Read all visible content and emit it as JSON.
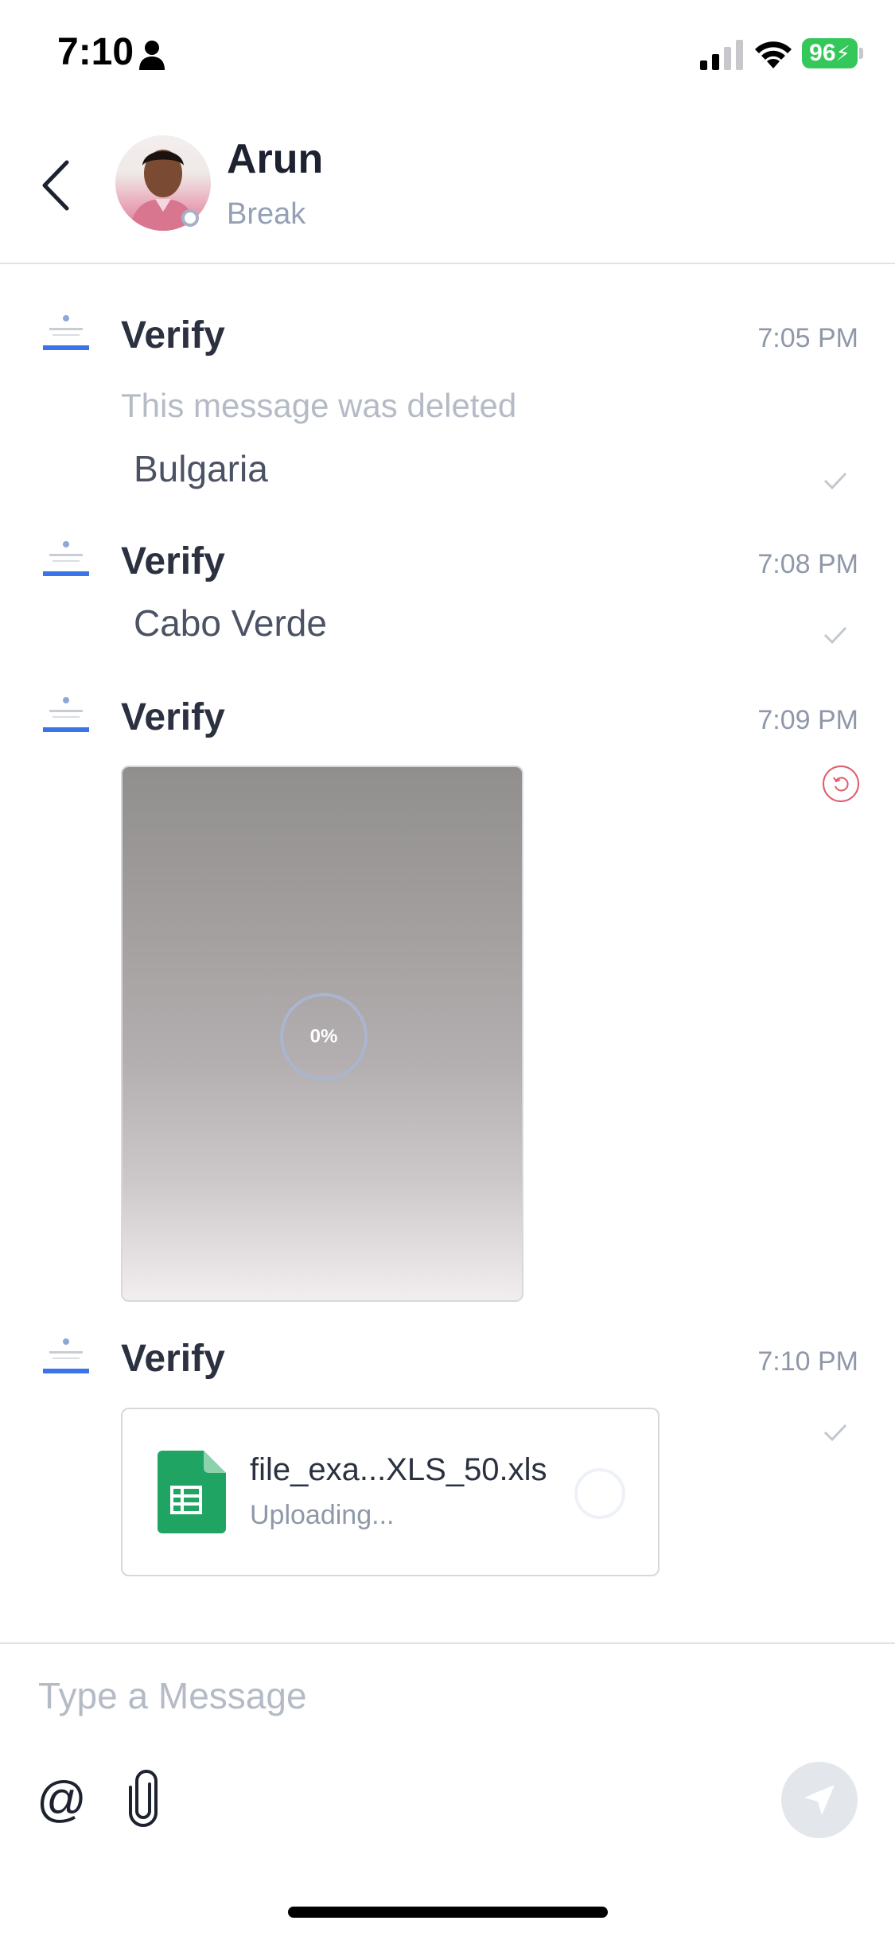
{
  "status_bar": {
    "time": "7:10",
    "battery": "96"
  },
  "header": {
    "name": "Arun",
    "status": "Break"
  },
  "messages": [
    {
      "sender": "Verify",
      "time": "7:05 PM",
      "deleted_text": "This message was deleted",
      "text": "Bulgaria"
    },
    {
      "sender": "Verify",
      "time": "7:08 PM",
      "text": "Cabo Verde"
    },
    {
      "sender": "Verify",
      "time": "7:09 PM",
      "image_progress": "0%"
    },
    {
      "sender": "Verify",
      "time": "7:10 PM",
      "file_name": "file_exa...XLS_50.xls",
      "file_status": "Uploading..."
    }
  ],
  "composer": {
    "placeholder": "Type a Message",
    "mention_symbol": "@"
  },
  "colors": {
    "accent_red": "#e05b6c",
    "file_green": "#1fa463",
    "battery_green": "#34c759"
  },
  "icons": [
    "person-icon",
    "signal-icon",
    "wifi-icon",
    "battery-icon",
    "back-chevron-icon",
    "checkmark-icon",
    "retry-icon",
    "spreadsheet-icon",
    "paperclip-icon",
    "send-icon"
  ]
}
